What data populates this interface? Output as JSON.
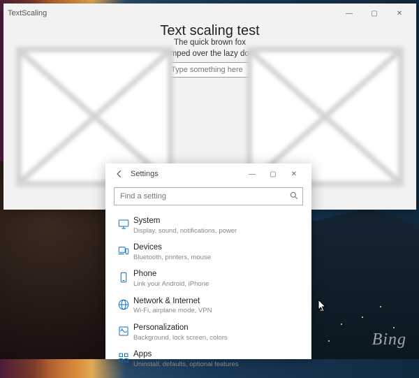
{
  "desktop": {
    "watermark": "Bing"
  },
  "textScalingWindow": {
    "title": "TextScaling",
    "heading": "Text scaling test",
    "subtitle_line1": "The quick brown fox",
    "subtitle_line2": "jumped over the lazy dog.",
    "input_placeholder": "Type something here",
    "controls": {
      "minimize": "—",
      "maximize": "▢",
      "close": "✕"
    }
  },
  "settingsWindow": {
    "title": "Settings",
    "search_placeholder": "Find a setting",
    "controls": {
      "back": "←",
      "minimize": "—",
      "maximize": "▢",
      "close": "✕"
    },
    "categories": [
      {
        "name": "System",
        "sub": "Display, sound, notifications, power",
        "icon": "system-icon"
      },
      {
        "name": "Devices",
        "sub": "Bluetooth, printers, mouse",
        "icon": "devices-icon"
      },
      {
        "name": "Phone",
        "sub": "Link your Android, iPhone",
        "icon": "phone-icon"
      },
      {
        "name": "Network & Internet",
        "sub": "Wi-Fi, airplane mode, VPN",
        "icon": "network-icon"
      },
      {
        "name": "Personalization",
        "sub": "Background, lock screen, colors",
        "icon": "personalization-icon"
      },
      {
        "name": "Apps",
        "sub": "Uninstall, defaults, optional features",
        "icon": "apps-icon"
      }
    ]
  }
}
